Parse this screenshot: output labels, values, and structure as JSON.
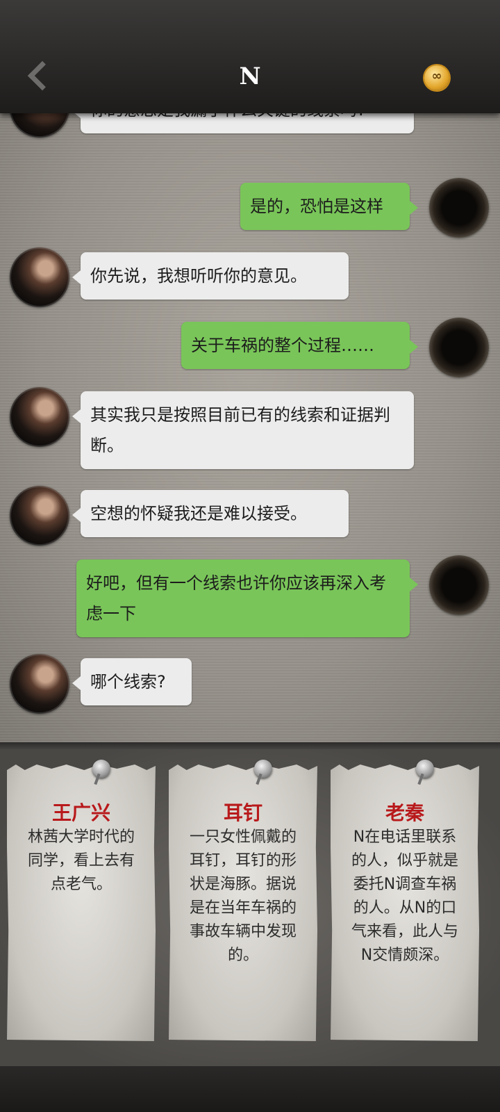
{
  "header": {
    "title": "N",
    "back_icon": "chevron-left-icon",
    "coin_icon": "infinity-coin-icon",
    "coin_symbol": "∞"
  },
  "messages": [
    {
      "side": "in",
      "text": "你的意思是我漏了什么关键的线索吗?"
    },
    {
      "side": "out",
      "text": "是的，恐怕是这样"
    },
    {
      "side": "in",
      "text": "你先说，我想听听你的意见。"
    },
    {
      "side": "out",
      "text": "关于车祸的整个过程……"
    },
    {
      "side": "in",
      "text": "其实我只是按照目前已有的线索和证据判断。"
    },
    {
      "side": "in",
      "text": "空想的怀疑我还是难以接受。"
    },
    {
      "side": "out",
      "text": "好吧，但有一个线索也许你应该再深入考虑一下"
    },
    {
      "side": "in",
      "text": "哪个线索?"
    }
  ],
  "clues": [
    {
      "title": "王广兴",
      "desc": "林茜大学时代的同学，看上去有点老气。"
    },
    {
      "title": "耳钉",
      "desc": "一只女性佩戴的耳钉，耳钉的形状是海豚。据说是在当年车祸的事故车辆中发现的。"
    },
    {
      "title": "老秦",
      "desc": "N在电话里联系的人，似乎就是委托N调查车祸的人。从N的口气来看，此人与N交情颇深。"
    }
  ],
  "colors": {
    "incoming_bubble": "#ececec",
    "outgoing_bubble": "#79c559",
    "clue_title": "#b8191b"
  }
}
